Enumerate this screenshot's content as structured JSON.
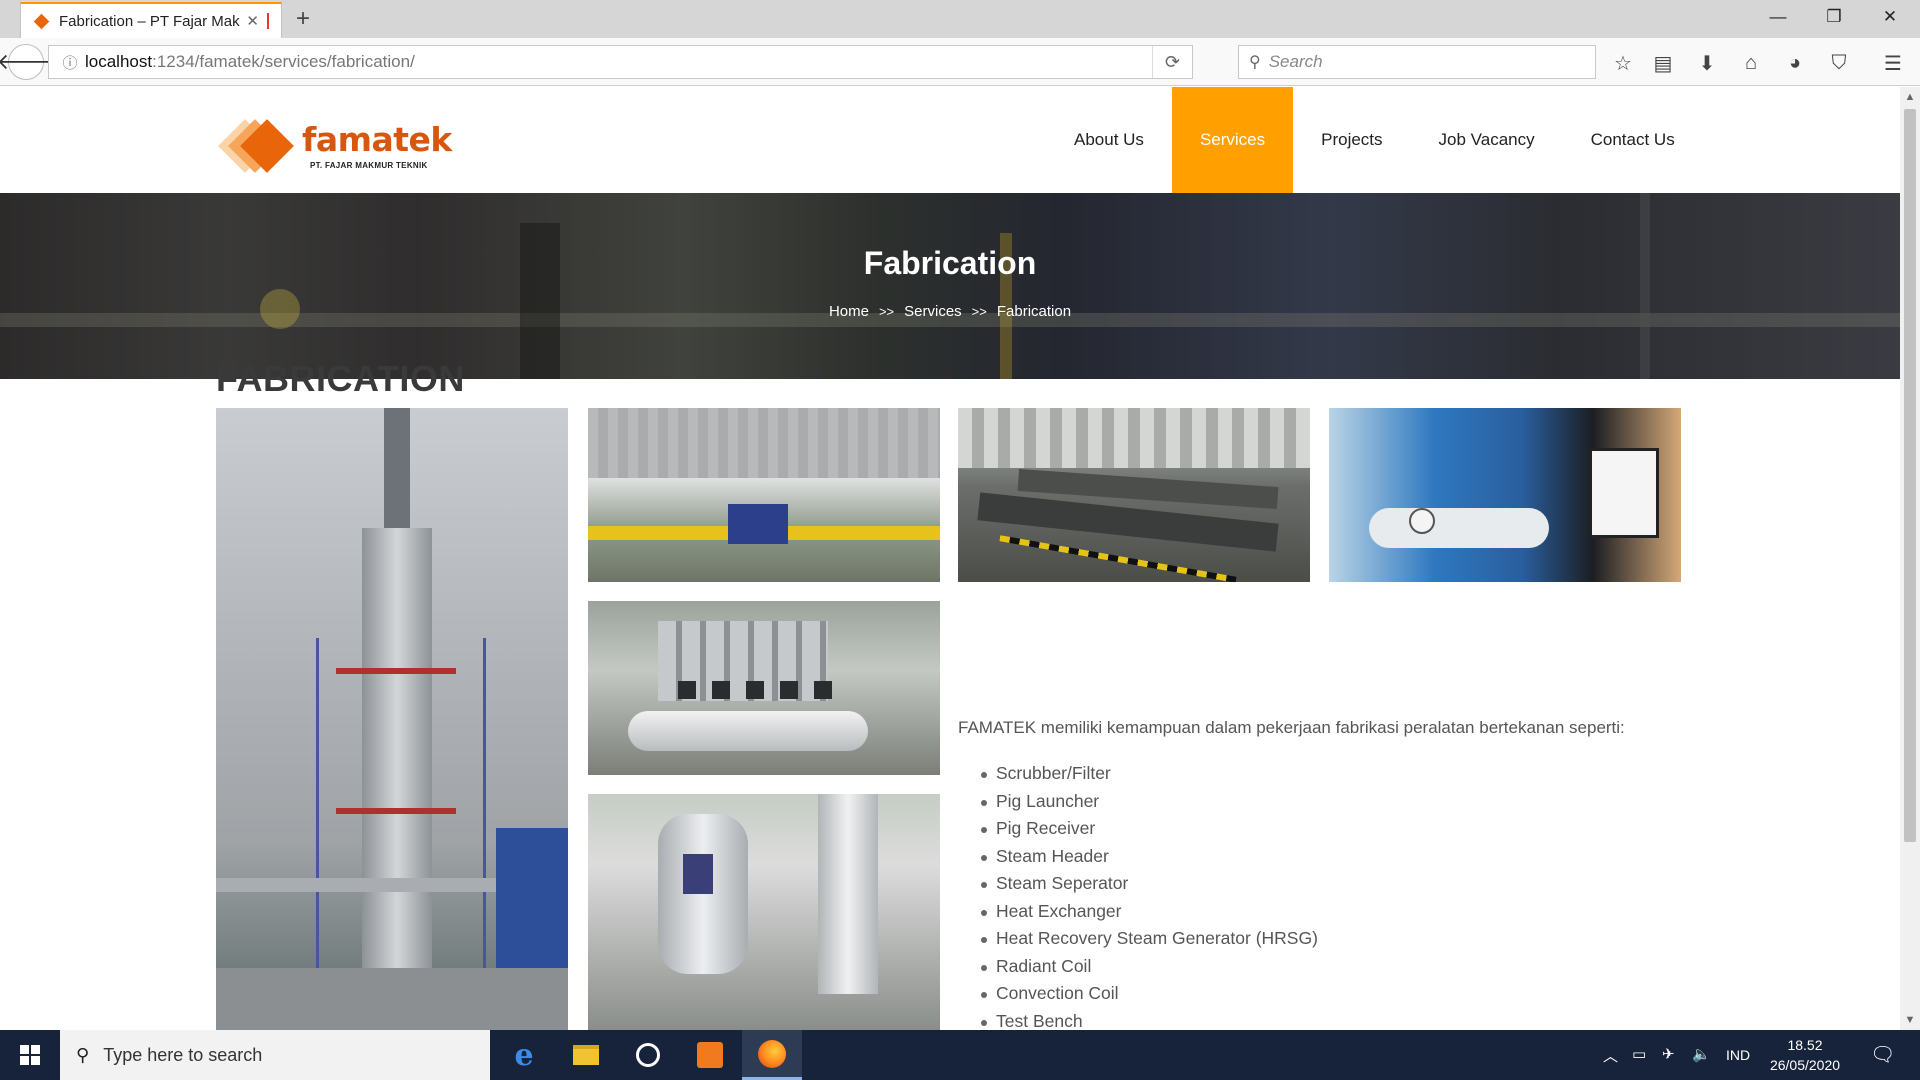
{
  "browser": {
    "tab_title": "Fabrication – PT Fajar Mak...",
    "tab_close": "✕",
    "new_tab": "+",
    "url_host": "localhost",
    "url_path": ":1234/famatek/services/fabrication/",
    "search_placeholder": "Search",
    "window_controls": {
      "minimize": "—",
      "restore": "❐",
      "close": "✕"
    },
    "toolbar_icons": [
      "star-icon",
      "reading-list-icon",
      "download-icon",
      "home-icon",
      "chat-icon",
      "pocket-icon",
      "menu-icon"
    ]
  },
  "site": {
    "logo": {
      "wordmark": "famatek",
      "tagline": "PT. FAJAR MAKMUR TEKNIK"
    },
    "menu": [
      {
        "label": "About Us",
        "active": false
      },
      {
        "label": "Services",
        "active": true
      },
      {
        "label": "Projects",
        "active": false
      },
      {
        "label": "Job Vacancy",
        "active": false
      },
      {
        "label": "Contact Us",
        "active": false
      }
    ],
    "hero": {
      "title": "Fabrication",
      "breadcrumb": {
        "home": "Home",
        "services": "Services",
        "current": "Fabrication",
        "separator": ">>"
      }
    },
    "section_title": "FABRICATION",
    "description": "FAMATEK memiliki kemampuan dalam pekerjaan fabrikasi peralatan bertekanan seperti:",
    "items": [
      "Scrubber/Filter",
      "Pig Launcher",
      "Pig Receiver",
      "Steam Header",
      "Steam Seperator",
      "Heat Exchanger",
      "Heat Recovery Steam Generator (HRSG)",
      "Radiant Coil",
      "Convection Coil",
      "Test Bench"
    ],
    "colors": {
      "accent": "#ffa000",
      "brand": "#d8570f",
      "heading": "#3a3a3a"
    }
  },
  "taskbar": {
    "search_placeholder": "Type here to search",
    "language": "IND",
    "time": "18.52",
    "date": "26/05/2020"
  }
}
